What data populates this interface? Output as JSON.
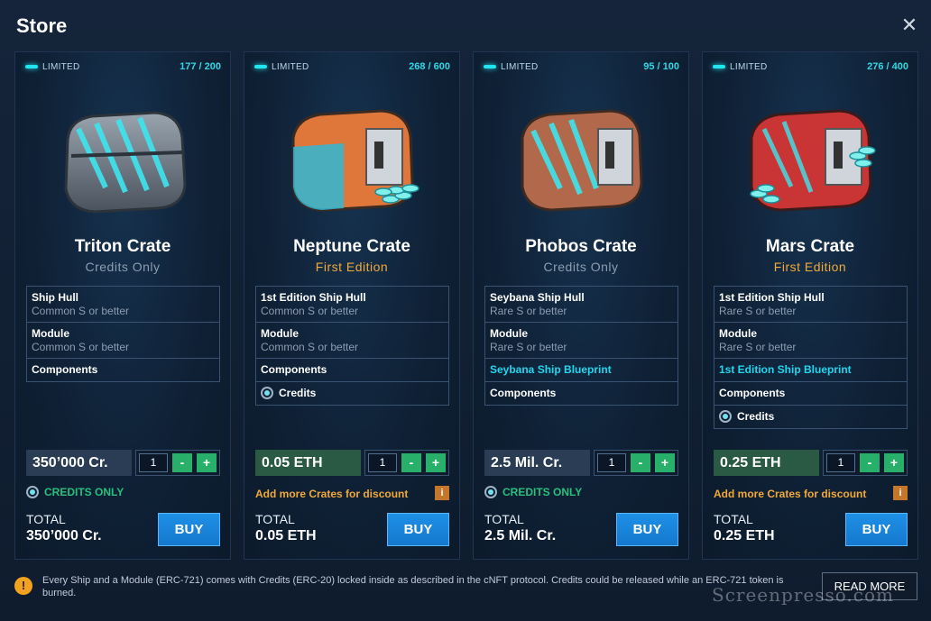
{
  "header": {
    "title": "Store",
    "close_label": "✕"
  },
  "colors": {
    "cyan": "#22d6ee",
    "green": "#28c07a",
    "orange": "#f0a93a",
    "buy_blue": "#1e90e6"
  },
  "cards": [
    {
      "limited": "LIMITED",
      "count": "177 / 200",
      "name": "Triton Crate",
      "sub": "Credits Only",
      "sub_color": "#8c9db1",
      "crate_color": "#6d7986",
      "crate_stripe": "#3de6f0",
      "features": [
        {
          "title": "Ship Hull",
          "sub": "Common S or better"
        },
        {
          "title": "Module",
          "sub": "Common S or better"
        },
        {
          "title": "Components"
        }
      ],
      "price": "350’000 Cr.",
      "qty": "1",
      "minus": "-",
      "plus": "+",
      "note": "CREDITS ONLY",
      "total_label": "TOTAL",
      "total": "350’000 Cr.",
      "buy": "BUY"
    },
    {
      "limited": "LIMITED",
      "count": "268 / 600",
      "name": "Neptune Crate",
      "sub": "First Edition",
      "sub_color": "#f0a93a",
      "crate_color": "#e0773a",
      "crate_stripe": "#2fb7d4",
      "features": [
        {
          "title": "1st Edition Ship Hull",
          "sub": "Common S or better"
        },
        {
          "title": "Module",
          "sub": "Common S or better"
        },
        {
          "title": "Components"
        },
        {
          "title": "Credits"
        }
      ],
      "price": "0.05 ETH",
      "qty": "1",
      "minus": "-",
      "plus": "+",
      "note": "Add more Crates for discount",
      "info": "i",
      "total_label": "TOTAL",
      "total": "0.05 ETH",
      "buy": "BUY"
    },
    {
      "limited": "LIMITED",
      "count": "95 / 100",
      "name": "Phobos Crate",
      "sub": "Credits Only",
      "sub_color": "#8c9db1",
      "crate_color": "#b2684a",
      "crate_stripe": "#3de6f0",
      "features": [
        {
          "title": "Seybana Ship Hull",
          "sub": "Rare S or better"
        },
        {
          "title": "Module",
          "sub": "Rare S or better"
        },
        {
          "title": "Seybana Ship Blueprint"
        },
        {
          "title": "Components"
        }
      ],
      "price": "2.5 Mil. Cr.",
      "qty": "1",
      "minus": "-",
      "plus": "+",
      "note": "CREDITS ONLY",
      "total_label": "TOTAL",
      "total": "2.5 Mil. Cr.",
      "buy": "BUY"
    },
    {
      "limited": "LIMITED",
      "count": "276 / 400",
      "name": "Mars Crate",
      "sub": "First Edition",
      "sub_color": "#f0a93a",
      "crate_color": "#c93434",
      "crate_stripe": "#3de6f0",
      "features": [
        {
          "title": "1st Edition Ship Hull",
          "sub": "Rare S or better"
        },
        {
          "title": "Module",
          "sub": "Rare S or better"
        },
        {
          "title": "1st Edition Ship Blueprint"
        },
        {
          "title": "Components"
        },
        {
          "title": "Credits"
        }
      ],
      "price": "0.25 ETH",
      "qty": "1",
      "minus": "-",
      "plus": "+",
      "note": "Add more Crates for discount",
      "info": "i",
      "total_label": "TOTAL",
      "total": "0.25 ETH",
      "buy": "BUY"
    }
  ],
  "footer": {
    "warn_icon": "!",
    "disclaimer": "Every Ship and a Module (ERC-721) comes with Credits (ERC-20) locked inside as described in the cNFT protocol. Credits could be released while an ERC-721 token is burned.",
    "read_more": "READ MORE"
  },
  "watermark": "Screenpresso.com"
}
